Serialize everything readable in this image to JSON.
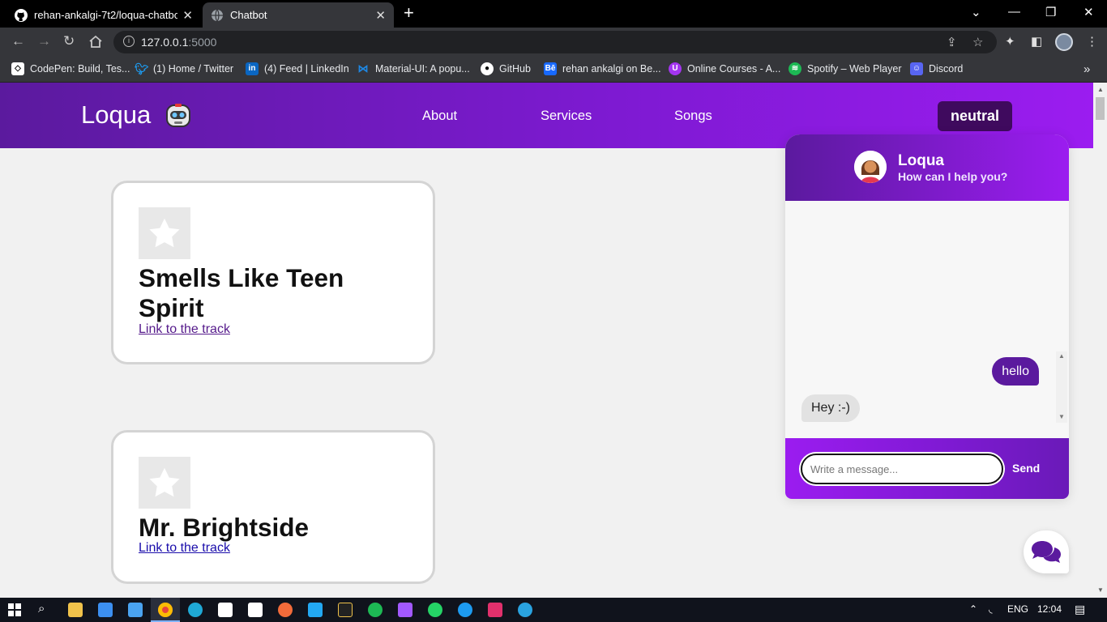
{
  "browser": {
    "tabs": [
      {
        "title": "rehan-ankalgi-7t2/loqua-chatbot",
        "icon": "github-icon"
      },
      {
        "title": "Chatbot",
        "icon": "globe-icon"
      }
    ],
    "url_host": "127.0.0.1",
    "url_port": ":5000",
    "bookmarks": [
      {
        "label": "CodePen: Build, Tes...",
        "icon": "codepen-icon",
        "color": "#ffffff"
      },
      {
        "label": "(1) Home / Twitter",
        "icon": "twitter-icon",
        "color": "#1d9bf0"
      },
      {
        "label": "(4) Feed | LinkedIn",
        "icon": "linkedin-icon",
        "color": "#0a66c2"
      },
      {
        "label": "Material-UI: A popu...",
        "icon": "mui-icon",
        "color": "#1e88e5"
      },
      {
        "label": "GitHub",
        "icon": "github-icon",
        "color": "#ffffff"
      },
      {
        "label": "rehan ankalgi on Be...",
        "icon": "behance-icon",
        "color": "#1769ff"
      },
      {
        "label": "Online Courses - A...",
        "icon": "udemy-icon",
        "color": "#a435f0"
      },
      {
        "label": "Spotify – Web Player",
        "icon": "spotify-icon",
        "color": "#1db954"
      },
      {
        "label": "Discord",
        "icon": "discord-icon",
        "color": "#e23a3a"
      }
    ]
  },
  "site": {
    "logo": "Loqua",
    "nav": [
      "About",
      "Services",
      "Songs"
    ],
    "mood": "neutral",
    "colors": {
      "gradient_start": "#5b1a9e",
      "gradient_end": "#9b1cf0",
      "mood_bg": "#3f0a5e"
    }
  },
  "songs": [
    {
      "title": "Smells Like Teen Spirit",
      "link": "Link to the track"
    },
    {
      "title": "Mr. Brightside",
      "link": "Link to the track"
    }
  ],
  "chat": {
    "name": "Loqua",
    "subtitle": "How can I help you?",
    "messages": [
      {
        "from": "user",
        "text": "hello"
      },
      {
        "from": "bot",
        "text": "Hey :-)"
      }
    ],
    "input_placeholder": "Write a message...",
    "send_label": "Send"
  },
  "taskbar": {
    "lang": "ENG",
    "time": "12:04"
  }
}
